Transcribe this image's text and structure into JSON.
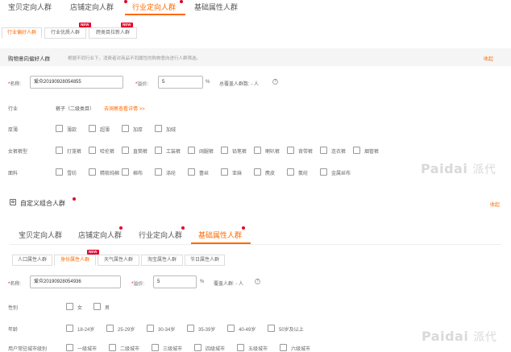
{
  "top_tabs": [
    {
      "label": "宝贝定向人群"
    },
    {
      "label": "店铺定向人群"
    },
    {
      "label": "行业定向人群"
    },
    {
      "label": "基础属性人群"
    }
  ],
  "top_subtabs": [
    {
      "label": "行业偏好人群"
    },
    {
      "label": "行业优质人群"
    },
    {
      "label": "跨类目拉新人群"
    }
  ],
  "new_badge": "NEW",
  "section1": {
    "title": "购物意向偏好人群",
    "desc": "根据不同行业下，消费者对商品不同属性的购物意向进行人群筛选。",
    "collapse": "收起"
  },
  "form1": {
    "name_label": "*名称:",
    "name_value": "爱众20190928054855",
    "premium_label": "*溢价:",
    "premium_value": "5",
    "percent": "%",
    "total_label": "总覆盖人群数: - 人",
    "help_icon": "?"
  },
  "industry": {
    "label": "行业",
    "value": "裤子（二级类目）",
    "link": "去洞察查看详情 >>"
  },
  "thickness": {
    "label": "厚薄",
    "options": [
      "薄款",
      "超薄",
      "加厚",
      "加绒"
    ]
  },
  "waist": {
    "label": "女裤裤型",
    "options": [
      "灯笼裤",
      "哈伦裤",
      "直筒裤",
      "工装裤",
      "阔腿裤",
      "铅笔裤",
      "喇叭裤",
      "背带裤",
      "连衣裤",
      "烟管裤"
    ]
  },
  "material": {
    "label": "面料",
    "options": [
      "雪纺",
      "精梳纯棉",
      "棉布",
      "涤纶",
      "蕾丝",
      "亚麻",
      "麂皮",
      "氨纶",
      "金属丝布"
    ]
  },
  "watermark": {
    "en": "Paidai",
    "cn": "派代"
  },
  "section2": {
    "title": "自定义组合人群",
    "collapse": "收起"
  },
  "mid_tabs": [
    {
      "label": "宝贝定向人群"
    },
    {
      "label": "店铺定向人群"
    },
    {
      "label": "行业定向人群"
    },
    {
      "label": "基础属性人群"
    }
  ],
  "mid_subtabs": [
    {
      "label": "人口属性人群"
    },
    {
      "label": "身份属性人群"
    },
    {
      "label": "天气属性人群"
    },
    {
      "label": "淘宝属性人群"
    },
    {
      "label": "节日属性人群"
    }
  ],
  "form2": {
    "name_label": "*名称:",
    "name_value": "爱众20190928054936",
    "premium_label": "*溢价:",
    "premium_value": "5",
    "percent": "%",
    "total_label": "覆盖人群: - 人",
    "help_icon": "?"
  },
  "gender": {
    "label": "性别",
    "options": [
      "女",
      "男"
    ]
  },
  "age": {
    "label": "年龄",
    "options": [
      "18-24岁",
      "25-29岁",
      "30-34岁",
      "35-39岁",
      "40-49岁",
      "50岁及以上"
    ]
  },
  "city": {
    "label": "用户常驻城市级别",
    "options": [
      "一级城市",
      "二级城市",
      "三级城市",
      "四级城市",
      "五级城市",
      "六级城市"
    ]
  }
}
